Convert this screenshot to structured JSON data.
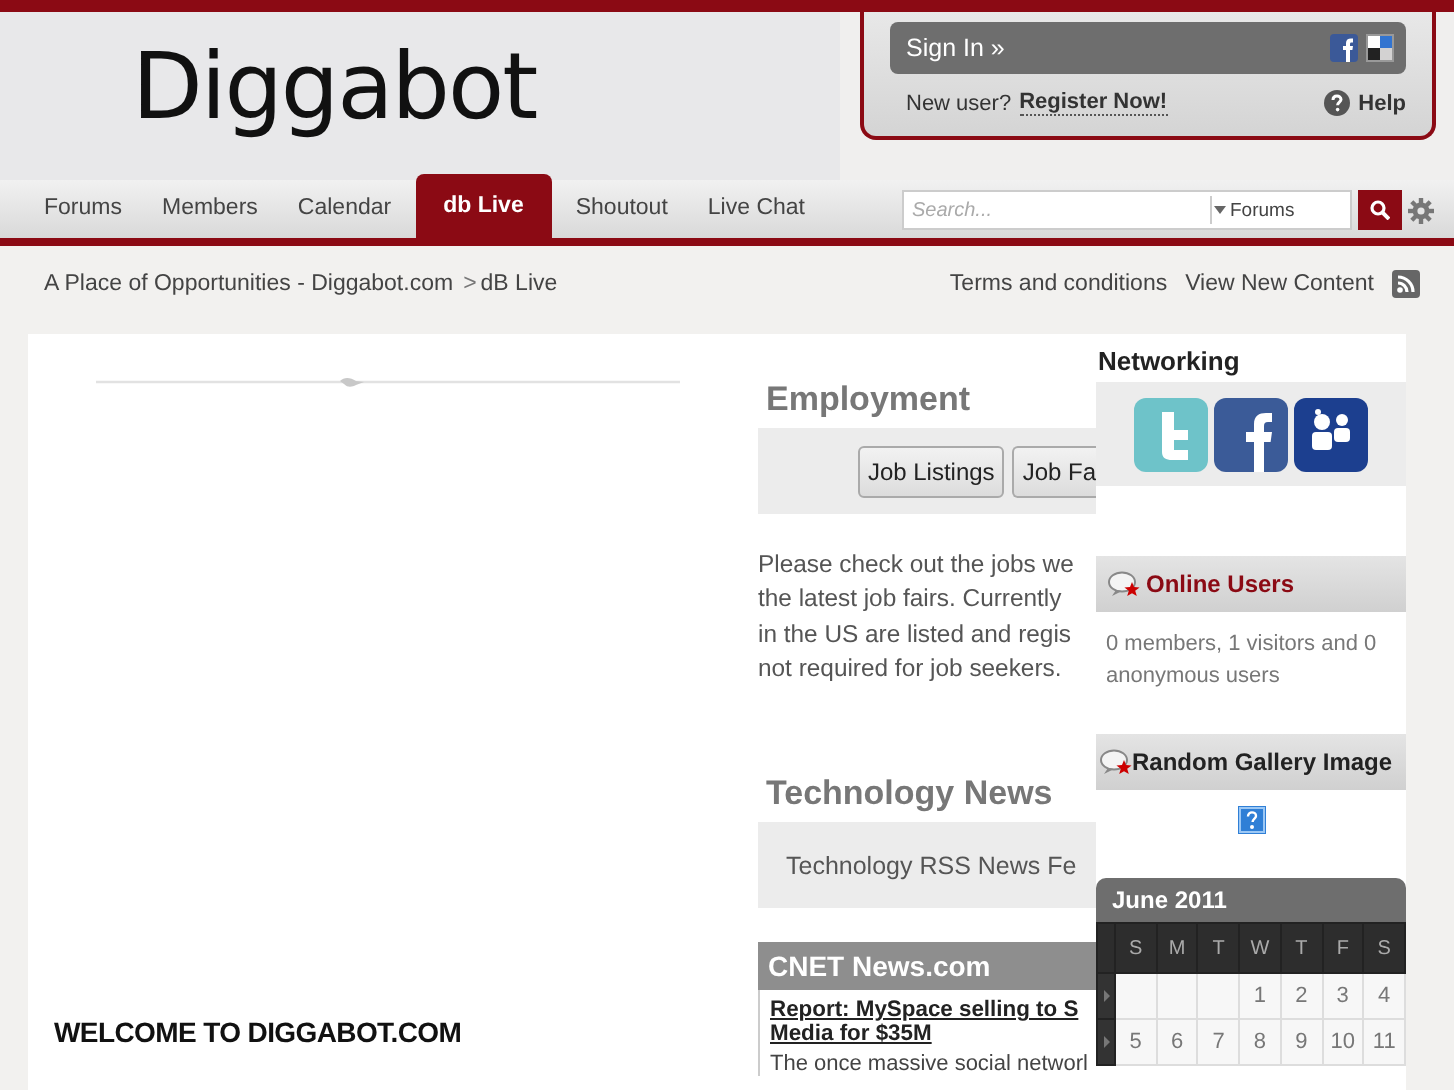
{
  "header": {
    "logo": "Diggabot",
    "sign_in": "Sign In »",
    "new_user": "New user?",
    "register": "Register Now!",
    "help": "Help"
  },
  "nav": {
    "tabs": [
      {
        "label": "Forums",
        "selected": false
      },
      {
        "label": "Members",
        "selected": false
      },
      {
        "label": "Calendar",
        "selected": false
      },
      {
        "label": "db Live",
        "selected": true
      },
      {
        "label": "Shoutout",
        "selected": false
      },
      {
        "label": "Live Chat",
        "selected": false
      }
    ],
    "search": {
      "placeholder": "Search...",
      "scope": "Forums"
    }
  },
  "breadcrumb": {
    "home": "A Place of Opportunities - Diggabot.com",
    "separator": ">",
    "current": "dB Live",
    "links": [
      "Terms and conditions",
      "View New Content"
    ]
  },
  "welcome": "WELCOME TO DIGGABOT.COM",
  "employment": {
    "title": "Employment",
    "buttons": [
      "Job Listings",
      "Job Fa"
    ],
    "lines": [
      "Please check out the jobs we",
      "the latest job fairs. Currently",
      "in the US are listed and regis",
      "not required for job seekers."
    ]
  },
  "technology": {
    "title": "Technology News",
    "box_text": "Technology RSS News Fe",
    "feed": {
      "title": "CNET News.com",
      "headline_lines": [
        "Report: MySpace selling to S",
        "Media for $35M"
      ],
      "excerpt": "The once massive social networl"
    }
  },
  "sidebar": {
    "networking": {
      "title": "Networking"
    },
    "online_users": {
      "title": "Online Users",
      "text": "0 members, 1 visitors and 0 anonymous users"
    },
    "gallery": {
      "title": "Random Gallery Image"
    },
    "calendar": {
      "month": "June 2011",
      "weekdays": [
        "S",
        "M",
        "T",
        "W",
        "T",
        "F",
        "S"
      ],
      "weeks": [
        [
          {
            "kind": "empty"
          },
          {
            "kind": "empty"
          },
          {
            "kind": "empty"
          },
          {
            "kind": "day",
            "day": "1"
          },
          {
            "kind": "day",
            "day": "2"
          },
          {
            "kind": "day",
            "day": "3"
          },
          {
            "kind": "day",
            "day": "4"
          }
        ],
        [
          {
            "kind": "day",
            "day": "5"
          },
          {
            "kind": "day",
            "day": "6"
          },
          {
            "kind": "day",
            "day": "7"
          },
          {
            "kind": "day",
            "day": "8"
          },
          {
            "kind": "day",
            "day": "9"
          },
          {
            "kind": "day",
            "day": "10"
          },
          {
            "kind": "day",
            "day": "11"
          }
        ]
      ]
    }
  }
}
